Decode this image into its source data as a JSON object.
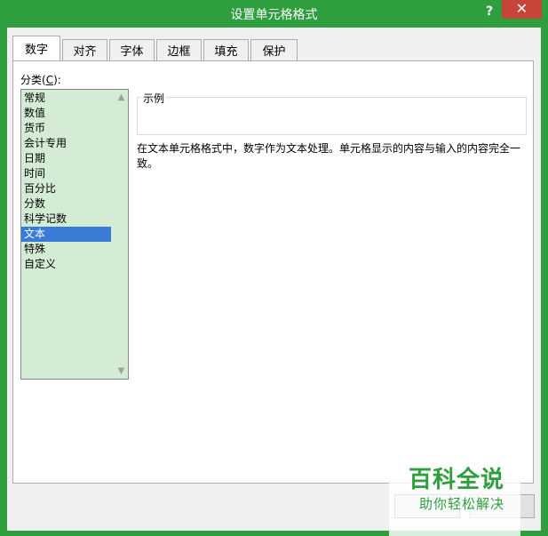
{
  "window": {
    "title": "设置单元格格式",
    "help_label": "?",
    "close_label": "✕"
  },
  "tabs": [
    {
      "label": "数字",
      "active": true
    },
    {
      "label": "对齐",
      "active": false
    },
    {
      "label": "字体",
      "active": false
    },
    {
      "label": "边框",
      "active": false
    },
    {
      "label": "填充",
      "active": false
    },
    {
      "label": "保护",
      "active": false
    }
  ],
  "category": {
    "label_prefix": "分类(",
    "label_key": "C",
    "label_suffix": "):",
    "items": [
      "常规",
      "数值",
      "货币",
      "会计专用",
      "日期",
      "时间",
      "百分比",
      "分数",
      "科学记数",
      "文本",
      "特殊",
      "自定义"
    ],
    "selected": "文本"
  },
  "sample": {
    "legend": "示例"
  },
  "description": "在文本单元格格式中，数字作为文本处理。单元格显示的内容与输入的内容完全一致。",
  "watermark": {
    "title": "百科全说",
    "subtitle": "助你轻松解决"
  },
  "colors": {
    "titlebar": "#2f9e3f",
    "close": "#c7443a",
    "list_bg": "#d4ebd4",
    "selection": "#3a7bd5"
  }
}
